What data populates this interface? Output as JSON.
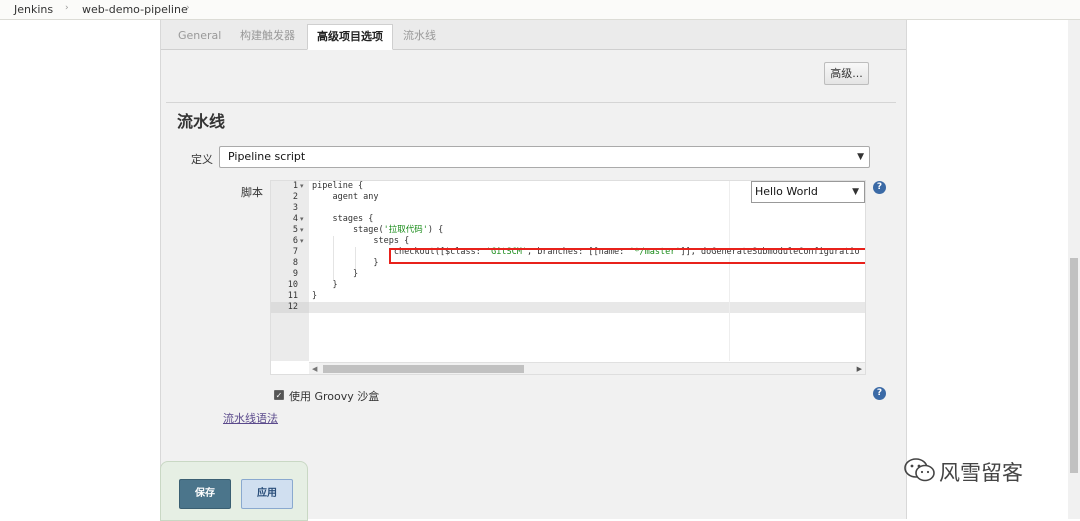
{
  "breadcrumb": {
    "items": [
      "Jenkins",
      "web-demo-pipeline"
    ],
    "separator": "›"
  },
  "tabs": [
    {
      "label": "General",
      "active": false
    },
    {
      "label": "构建触发器",
      "active": false
    },
    {
      "label": "高级项目选项",
      "active": true
    },
    {
      "label": "流水线",
      "active": false
    }
  ],
  "advanced_button": "高级...",
  "pipeline": {
    "section_title": "流水线",
    "definition_label": "定义",
    "definition_value": "Pipeline script",
    "script_label": "脚本",
    "sample_select": "Hello World",
    "line_numbers": [
      "1",
      "2",
      "3",
      "4",
      "5",
      "6",
      "7",
      "8",
      "9",
      "10",
      "11",
      "12"
    ],
    "code_lines": [
      "pipeline {",
      "    agent any",
      "",
      "    stages {",
      "        stage('拉取代码') {",
      "            steps {",
      "                checkout([$class: 'GitSCM', branches: [[name: '*/master']], doGenerateSubmoduleConfiguratio",
      "            }",
      "        }",
      "    }",
      "}",
      ""
    ],
    "groovy_sandbox_label": "使用 Groovy 沙盒",
    "groovy_sandbox_checked": true,
    "syntax_link": "流水线语法"
  },
  "buttons": {
    "save": "保存",
    "apply": "应用"
  },
  "help_icon": "?",
  "watermark": "风雪留客",
  "colors": {
    "highlight_box": "#e8211b",
    "save_button": "#4b758b",
    "apply_button": "#d0dff0",
    "string_literal": "#1a8c1a"
  }
}
